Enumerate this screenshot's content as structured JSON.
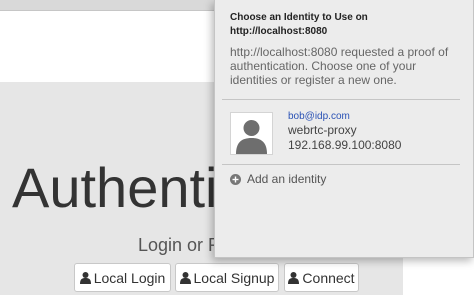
{
  "page": {
    "title": "Authenti",
    "subtitle": "Login or R",
    "buttons": {
      "local_login": "Local Login",
      "local_signup": "Local Signup",
      "connect": "Connect"
    }
  },
  "popup": {
    "title": "Choose an Identity to Use on http://localhost:8080",
    "message": "http://localhost:8080 requested a proof of authentication. Choose one of your identities or register a new one.",
    "identity": {
      "email": "bob@idp.com",
      "name": "webrtc-proxy",
      "host": "192.168.99.100:8080"
    },
    "add_identity": "Add an identity"
  },
  "icons": {
    "user": "user-icon",
    "avatar": "avatar-icon",
    "add": "plus-circle-icon"
  },
  "colors": {
    "popup_bg": "#ececec",
    "link": "#2a52b5",
    "page_band": "#e6e6e6"
  }
}
